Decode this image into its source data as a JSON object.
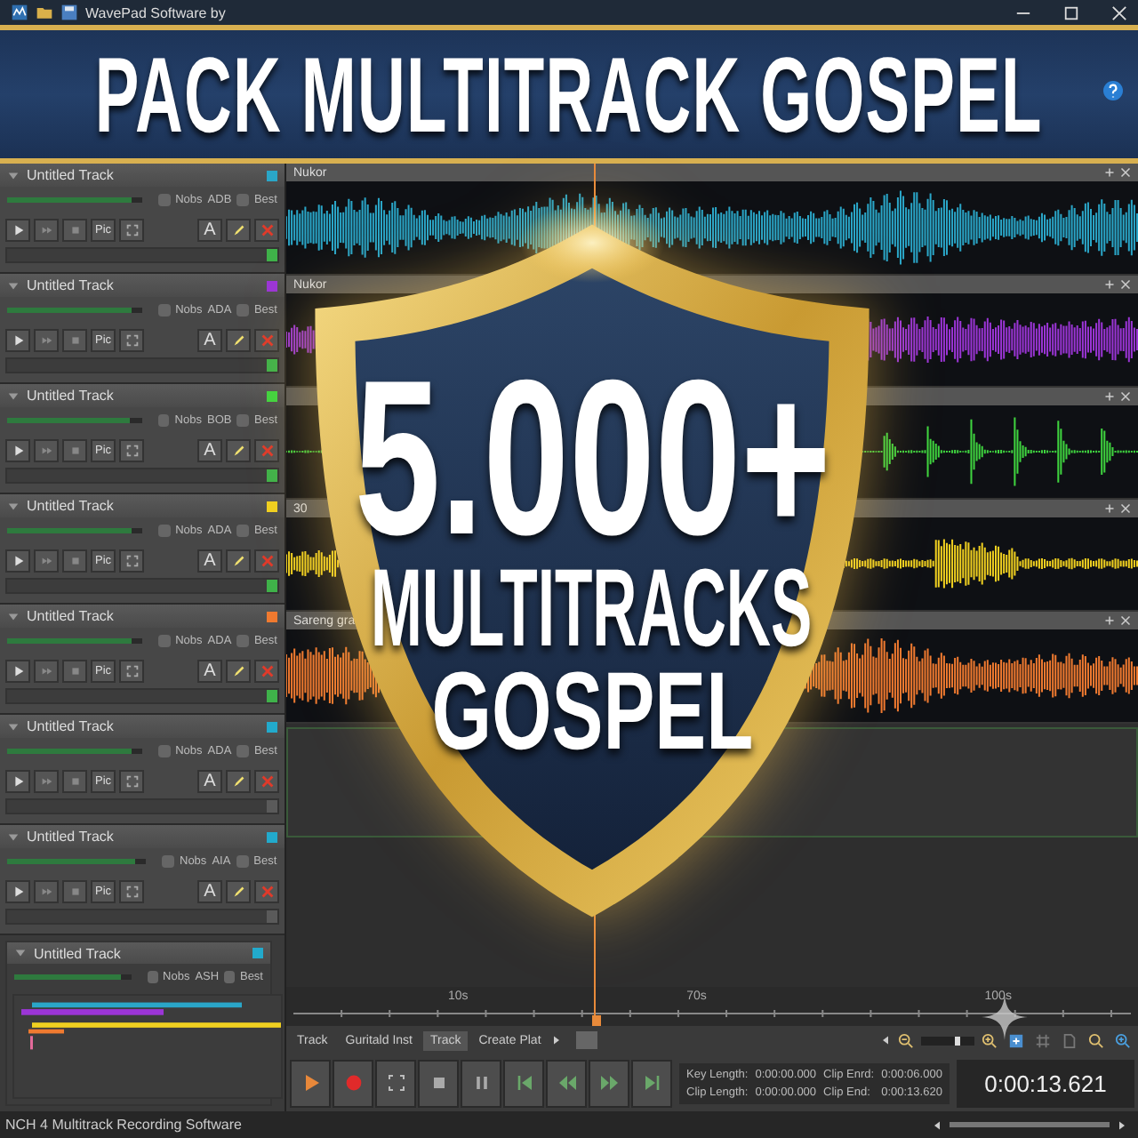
{
  "window": {
    "title": "WavePad Software by"
  },
  "banner": {
    "title": "PACK MULTITRACK GOSPEL"
  },
  "badge": {
    "count": "5.000+",
    "line_1": "MULTITRACKS",
    "line_2": "GOSPEL"
  },
  "tracks": [
    {
      "kind": "full",
      "name": "Untitled Track",
      "color": "#2aa6c8",
      "level": 0.92,
      "volume_label": "Nobs",
      "code": "ADB",
      "quality": "Best",
      "button_label": "Pic",
      "tool_label": "A",
      "meter_on": true
    },
    {
      "kind": "full",
      "name": "Untitled Track",
      "color": "#9b35d6",
      "level": 0.92,
      "volume_label": "Nobs",
      "code": "ADA",
      "quality": "Best",
      "button_label": "Pic",
      "tool_label": "A",
      "meter_on": true
    },
    {
      "kind": "full",
      "name": "Untitled Track",
      "color": "#3fd43f",
      "level": 0.92,
      "volume_label": "Nobs",
      "code": "BOB",
      "quality": "Best",
      "button_label": "Pic",
      "tool_label": "A",
      "meter_on": true
    },
    {
      "kind": "full",
      "name": "Untitled Track",
      "color": "#f0d020",
      "level": 0.92,
      "volume_label": "Nobs",
      "code": "ADA",
      "quality": "Best",
      "button_label": "Pic",
      "tool_label": "A",
      "meter_on": true
    },
    {
      "kind": "full",
      "name": "Untitled Track",
      "color": "#f07a30",
      "level": 0.92,
      "volume_label": "Nobs",
      "code": "ADA",
      "quality": "Best",
      "button_label": "Pic",
      "tool_label": "A",
      "meter_on": true
    },
    {
      "kind": "full",
      "name": "Untitled Track",
      "color": "#22aacc",
      "level": 0.92,
      "volume_label": "Nobs",
      "code": "ADA",
      "quality": "Best",
      "button_label": "Pic",
      "tool_label": "A",
      "meter_on": false
    },
    {
      "kind": "full",
      "name": "Untitled Track",
      "color": "#22aacc",
      "level": 0.92,
      "volume_label": "Nobs",
      "code": "AIA",
      "quality": "Best",
      "button_label": "Pic",
      "tool_label": "A",
      "meter_on": false
    },
    {
      "kind": "overview",
      "name": "Untitled Track",
      "color": "#22aacc",
      "level": 0.92,
      "volume_label": "Nobs",
      "code": "ASH",
      "quality": "Best"
    }
  ],
  "lanes": [
    {
      "kind": "full",
      "label": "Nukor",
      "color": "#2aa6c8"
    },
    {
      "kind": "late",
      "label": "Nukor",
      "color": "#9b35d6"
    },
    {
      "kind": "pulses",
      "color": "#3fd43f"
    },
    {
      "kind": "burst",
      "label": "30",
      "color": "#f0d020"
    },
    {
      "kind": "full",
      "label": "Sareng gra",
      "color": "#f07a30"
    }
  ],
  "ruler": {
    "ticks": [
      "10s",
      "70s",
      "100s"
    ]
  },
  "zoom": {
    "level": 0.68
  },
  "tabs": [
    {
      "label": "Track",
      "selected": false
    },
    {
      "label": "Guritald Inst",
      "selected": false
    },
    {
      "label": "Track",
      "selected": true
    },
    {
      "label": "Create Plat",
      "selected": false
    }
  ],
  "info": [
    {
      "label": "Key Length:",
      "value": "0:00:00.000"
    },
    {
      "label": "Clip Enrd:",
      "value": "0:00:06.000"
    },
    {
      "label": "Clip Length:",
      "value": "0:00:00.000"
    },
    {
      "label": "Clip End:",
      "value": "0:00:13.620"
    }
  ],
  "time": "0:00:13.621",
  "status_bar": "NCH 4 Multitrack Recording Software"
}
